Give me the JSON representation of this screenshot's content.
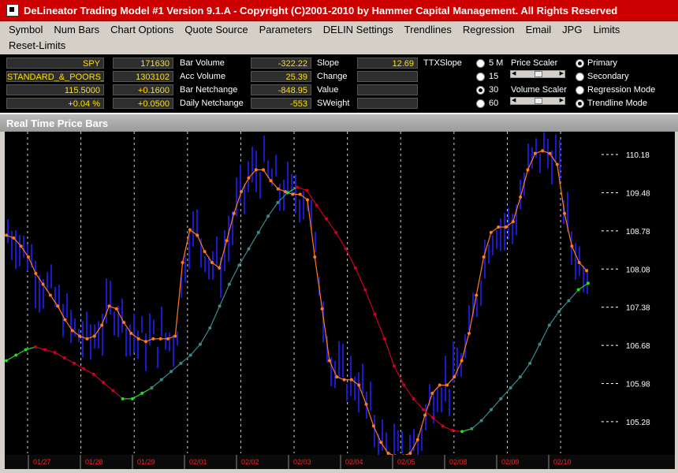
{
  "window": {
    "title": "DeLineator Trading Model #1 Version 9.1.A - Copyright (C)2001-2010 by Hammer Capital Management. All Rights Reserved"
  },
  "menu": {
    "items": [
      "Symbol",
      "Num Bars",
      "Chart Options",
      "Quote Source",
      "Parameters",
      "DELIN Settings",
      "Trendlines",
      "Regression",
      "Email",
      "JPG",
      "Limits"
    ],
    "items_row2": [
      "Reset-Limits"
    ]
  },
  "info": {
    "symbol": "SPY",
    "name": "STANDARD_&_POORS_",
    "price": "115.5000",
    "pct_change": "+0.04 %",
    "bar_volume": "171630",
    "acc_volume": "1303102",
    "bar_netchange": "+0.1600",
    "daily_netchange": "+0.0500",
    "labels1": [
      "Bar Volume",
      "Acc Volume",
      "Bar Netchange",
      "Daily Netchange"
    ],
    "vals3": [
      "-322.22",
      "25.39",
      "-848.95",
      "-553"
    ],
    "labels2": [
      "Slope",
      "Change",
      "Value",
      "SWeight"
    ],
    "vals4": [
      "12.69",
      "",
      "",
      ""
    ],
    "ttx_label": "TTXSlope",
    "intervals": [
      "5 M",
      "15",
      "30",
      "60"
    ],
    "interval_selected": 2,
    "price_scaler_label": "Price Scaler",
    "volume_scaler_label": "Volume Scaler",
    "modes": [
      "Primary",
      "Secondary",
      "Regression Mode",
      "Trendline Mode"
    ],
    "mode_selected": [
      0,
      3
    ]
  },
  "chart_header": "Real Time Price Bars",
  "chart_data": {
    "type": "line",
    "y_ticks": [
      110.18,
      109.48,
      108.78,
      108.08,
      107.38,
      106.68,
      105.98,
      105.28
    ],
    "ylim": [
      104.7,
      110.6
    ],
    "date_labels": [
      "01/27",
      "01/28",
      "01/29",
      "02/01",
      "02/02",
      "02/03",
      "02/04",
      "02/05",
      "02/08",
      "02/09",
      "02/10"
    ],
    "colors": {
      "background": "#000000",
      "price_bars": "#1a1acc",
      "orange_line": "#ff7a1a",
      "trend_up": "#22dd22",
      "trend_mid": "#3a8a8a",
      "trend_down": "#cc0022",
      "date_text": "#ff2020"
    },
    "series": [
      {
        "values": [
          108.7,
          108.65,
          108.5,
          108.3,
          108.0,
          107.8,
          107.6,
          107.4,
          107.15,
          106.95,
          106.85,
          106.8,
          106.85,
          107.05,
          107.4,
          107.35,
          107.1,
          106.9,
          106.8,
          106.75,
          106.8,
          106.8,
          106.8,
          106.85,
          108.2,
          108.8,
          108.7,
          108.4,
          108.2,
          108.1,
          108.6,
          109.1,
          109.5,
          109.75,
          109.9,
          109.9,
          109.7,
          109.55,
          109.5,
          109.45,
          109.45,
          109.35,
          108.3,
          107.35,
          106.4,
          106.1,
          106.05,
          106.05,
          105.95,
          105.6,
          105.2,
          104.9,
          104.7,
          104.65,
          104.65,
          104.7,
          104.95,
          105.4,
          105.8,
          105.95,
          105.95,
          106.1,
          106.4,
          106.9,
          107.6,
          108.3,
          108.75,
          108.85,
          108.85,
          108.95,
          109.4,
          109.9,
          110.2,
          110.25,
          110.2,
          110.0,
          109.1,
          108.5,
          108.2,
          108.05
        ]
      },
      {
        "values": [
          106.4,
          106.5,
          106.6,
          106.65,
          106.6,
          106.55,
          106.45,
          106.35,
          106.25,
          106.15,
          106.0,
          105.85,
          105.7,
          105.7,
          105.8,
          105.9,
          106.05,
          106.2,
          106.35,
          106.5,
          106.7,
          107.0,
          107.4,
          107.8,
          108.15,
          108.45,
          108.75,
          109.05,
          109.3,
          109.48,
          109.58,
          109.52,
          109.25,
          109.0,
          108.75,
          108.45,
          108.1,
          107.7,
          107.25,
          106.8,
          106.3,
          105.95,
          105.7,
          105.5,
          105.35,
          105.2,
          105.12,
          105.1,
          105.15,
          105.3,
          105.5,
          105.7,
          105.9,
          106.1,
          106.35,
          106.7,
          107.05,
          107.3,
          107.5,
          107.7,
          107.82
        ]
      }
    ]
  }
}
